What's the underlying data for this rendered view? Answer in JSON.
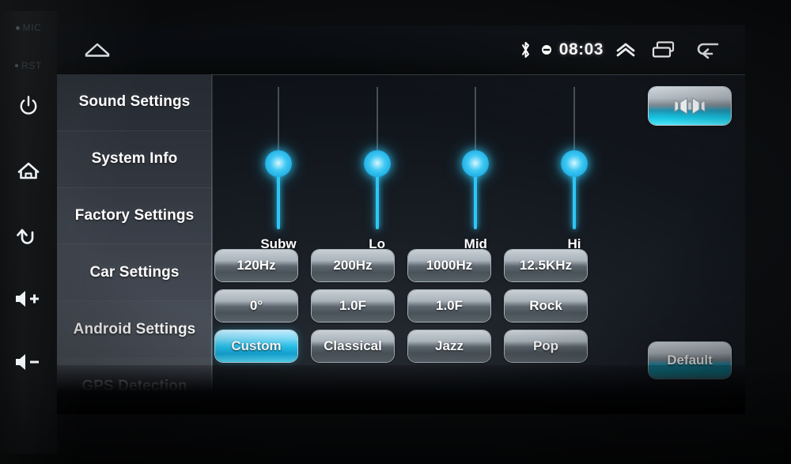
{
  "device": {
    "bezel_buttons": [
      {
        "name": "mic",
        "label": "MIC"
      },
      {
        "name": "reset",
        "label": "RST"
      },
      {
        "name": "power",
        "label": ""
      },
      {
        "name": "home",
        "label": ""
      },
      {
        "name": "back",
        "label": ""
      },
      {
        "name": "volume-up",
        "label": ""
      },
      {
        "name": "volume-down",
        "label": ""
      }
    ]
  },
  "statusbar": {
    "home_icon": "home-icon",
    "bluetooth_icon": "bluetooth-icon",
    "dot_icon": "mute-dot-icon",
    "time": "08:03",
    "expand_icon": "chevron-up-icon",
    "recents_icon": "recents-icon",
    "back_icon": "back-arrow-icon"
  },
  "sidebar": {
    "items": [
      {
        "label": "Sound Settings",
        "active": true
      },
      {
        "label": "System Info",
        "active": false
      },
      {
        "label": "Factory Settings",
        "active": false
      },
      {
        "label": "Car Settings",
        "active": false
      },
      {
        "label": "Android Settings",
        "active": false
      },
      {
        "label": "GPS Detection",
        "active": false
      }
    ]
  },
  "equalizer": {
    "sliders": [
      {
        "label": "Subw",
        "value_pct": 50
      },
      {
        "label": "Lo",
        "value_pct": 50
      },
      {
        "label": "Mid",
        "value_pct": 50
      },
      {
        "label": "Hi",
        "value_pct": 50
      }
    ],
    "rows": [
      {
        "name": "frequency-row",
        "buttons": [
          {
            "label": "120Hz",
            "selected": false
          },
          {
            "label": "200Hz",
            "selected": false
          },
          {
            "label": "1000Hz",
            "selected": false
          },
          {
            "label": "12.5KHz",
            "selected": false
          }
        ]
      },
      {
        "name": "parameter-row",
        "buttons": [
          {
            "label": "0°",
            "selected": false
          },
          {
            "label": "1.0F",
            "selected": false
          },
          {
            "label": "1.0F",
            "selected": false
          },
          {
            "label": "Rock",
            "selected": false
          }
        ]
      },
      {
        "name": "preset-row",
        "buttons": [
          {
            "label": "Custom",
            "selected": true
          },
          {
            "label": "Classical",
            "selected": false
          },
          {
            "label": "Jazz",
            "selected": false
          },
          {
            "label": "Pop",
            "selected": false
          }
        ]
      }
    ],
    "balance_button": {
      "icon": "balance-fader-icon"
    },
    "default_button": {
      "label": "Default"
    }
  },
  "colors": {
    "accent_cyan": "#2ec6f5",
    "sidebar_text": "#ffffff",
    "button_metal_light": "#c9d0d6",
    "button_metal_dark": "#4a5259",
    "screen_bg": "#1a1f26"
  }
}
